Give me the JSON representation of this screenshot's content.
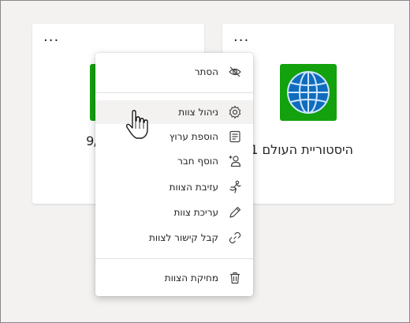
{
  "cards": [
    {
      "name": "היסטוריית העולם 201",
      "more_label": "..."
    },
    {
      "name": "מ 9/10",
      "more_label": "..."
    }
  ],
  "menu": {
    "hide": "הסתר",
    "manage": "ניהול צוות",
    "add_channel": "הוספת ערוץ",
    "add_member": "הוסף חבר",
    "leave": "עזיבת הצוות",
    "edit": "עריכת צוות",
    "get_link": "קבל קישור לצוות",
    "delete": "מחיקת הצוות"
  },
  "colors": {
    "team_tile": "#13a10e",
    "globe": "#0f6cbd"
  },
  "icons": [
    "hide-icon",
    "gear-icon",
    "channel-icon",
    "add-person-icon",
    "leave-icon",
    "pencil-icon",
    "link-icon",
    "trash-icon",
    "hand-cursor-icon"
  ]
}
